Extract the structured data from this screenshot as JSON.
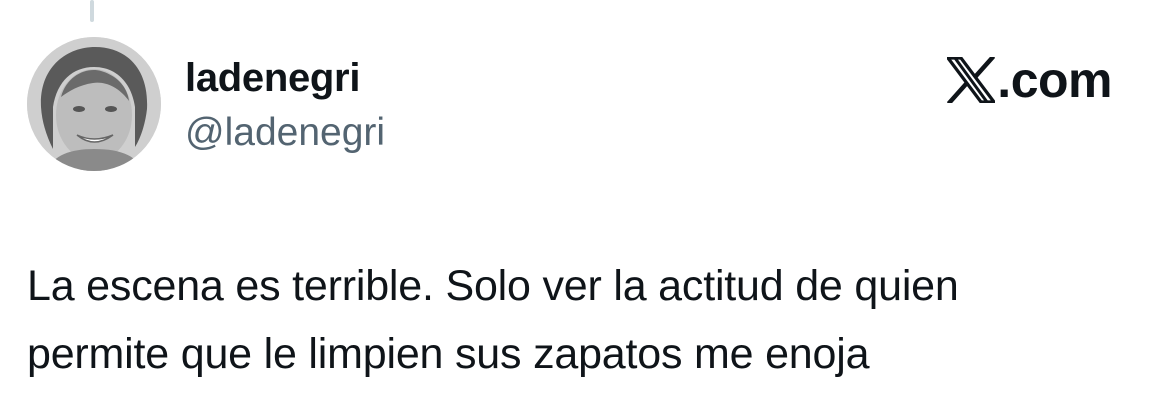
{
  "author": {
    "display_name": "ladenegri",
    "handle": "@ladenegri",
    "avatar_icon": "profile-photo"
  },
  "brand": {
    "logo_icon": "x-logo-icon",
    "domain_suffix": ".com"
  },
  "tweet": {
    "lines": [
      "La escena es terrible. Solo ver la actitud de quien",
      "permite que le limpien sus zapatos me enoja"
    ]
  },
  "colors": {
    "text_primary": "#0f1419",
    "text_secondary": "#536471",
    "thread_line": "#cfd9de",
    "background": "#ffffff"
  }
}
